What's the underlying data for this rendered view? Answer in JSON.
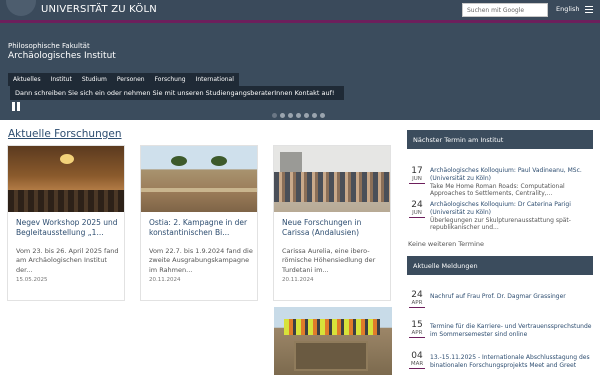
{
  "topbar": {
    "university": "UNIVERSITÄT ZU KÖLN",
    "search_placeholder": "Suchen mit Google",
    "language": "English"
  },
  "header": {
    "faculty": "Philosophische Fakultät",
    "institute": "Archäologisches Institut",
    "nav": [
      "Aktuelles",
      "Institut",
      "Studium",
      "Personen",
      "Forschung",
      "International"
    ],
    "banner": "Dann schreiben Sie sich ein oder nehmen Sie mit unseren StudiengangsberaterInnen Kontakt auf!",
    "slide_count": 7
  },
  "main": {
    "section_title": "Aktuelle Forschungen",
    "cards": [
      {
        "title": "Negev Workshop 2025 und Begleitausstellung „1...",
        "text": "Vom 23. bis 26. April 2025 fand am Archäologischen Institut der...",
        "date": "15.05.2025"
      },
      {
        "title": "Ostia: 2. Kampagne in der konstantinischen Bi...",
        "text": "Vom 22.7. bis 1.9.2024 fand die zweite Ausgrabungskampagne im Rahmen...",
        "date": "20.11.2024"
      },
      {
        "title": "Neue Forschungen in Carissa (Andalusien)",
        "text": "Carissa Aurelia, eine ibero-römische Höhensiedlung der Turdetani im...",
        "date": "20.11.2024"
      }
    ]
  },
  "sidebar": {
    "events_title": "Nächster Termin am Institut",
    "events": [
      {
        "day": "17",
        "month": "JUN",
        "title": "Archäologisches Kolloquium: Paul Vadineanu, MSc. (Universität zu Köln)",
        "subtitle": "Take Me Home Roman Roads: Computational Approaches to Settlements, Centrality,..."
      },
      {
        "day": "24",
        "month": "JUN",
        "title": "Archäologisches Kolloquium: Dr Caterina Parigi (Universität zu Köln)",
        "subtitle": "Überlegungen zur Skulpturenausstattung spät-republikanischer und..."
      }
    ],
    "no_more_events": "Keine weiteren Termine",
    "news_title": "Aktuelle Meldungen",
    "news": [
      {
        "day": "24",
        "month": "APR",
        "title": "Nachruf auf Frau Prof. Dr. Dagmar Grassinger"
      },
      {
        "day": "15",
        "month": "APR",
        "title": "Termine für die Karriere- und Vertrauenssprechstunde im Sommersemester sind online"
      },
      {
        "day": "04",
        "month": "MAR",
        "title": "13.-15.11.2025 - Internationale Abschlusstagung des binationalen Forschungsprojekts Meet and Greet"
      }
    ]
  },
  "colors": {
    "header_bg": "#3b4c5d",
    "accent": "#6d1f5c",
    "link": "#2d4d70"
  }
}
